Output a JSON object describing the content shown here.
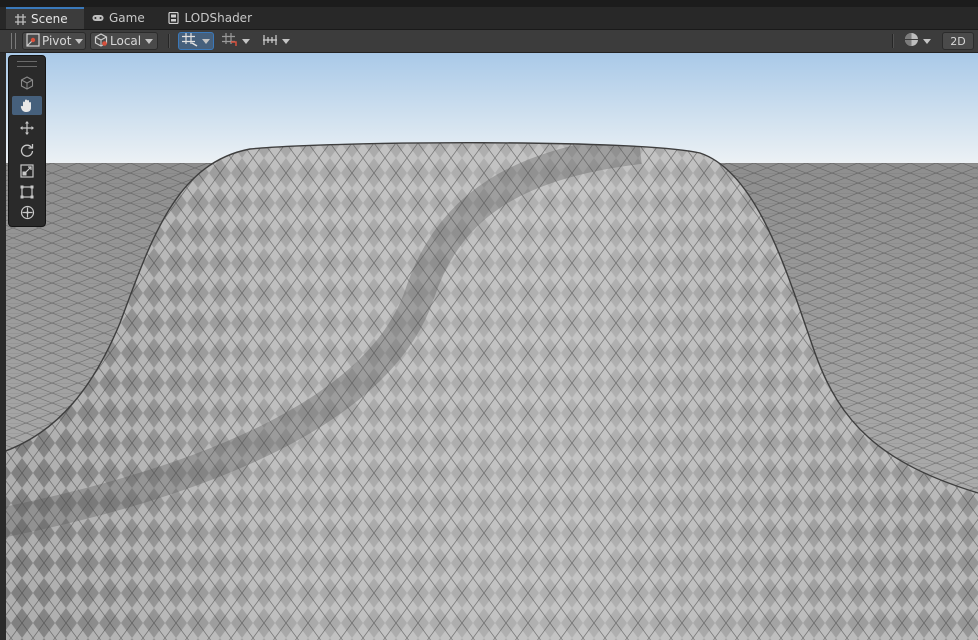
{
  "tabs": [
    {
      "label": "Scene",
      "icon": "grid-icon",
      "active": true
    },
    {
      "label": "Game",
      "icon": "gamepad-icon",
      "active": false
    },
    {
      "label": "LODShader",
      "icon": "shader-graph-icon",
      "active": false
    }
  ],
  "toolbar": {
    "pivot_label": "Pivot",
    "local_label": "Local",
    "two_d_label": "2D"
  },
  "tools": [
    {
      "name": "view-cube-icon",
      "selected": false
    },
    {
      "name": "hand-icon",
      "selected": true
    },
    {
      "name": "move-icon",
      "selected": false
    },
    {
      "name": "rotate-icon",
      "selected": false
    },
    {
      "name": "scale-icon",
      "selected": false
    },
    {
      "name": "rect-icon",
      "selected": false
    },
    {
      "name": "transform-icon",
      "selected": false
    }
  ],
  "colors": {
    "accent": "#3a79bb",
    "sky_top": "#a9c9e8",
    "sky_horizon": "#e6eef4",
    "mesh": "#9c9c9c"
  }
}
